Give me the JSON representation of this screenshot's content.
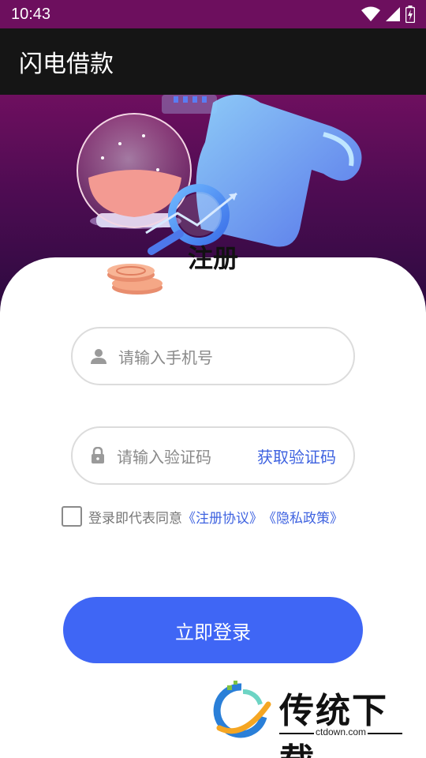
{
  "status_bar": {
    "time": "10:43"
  },
  "app_bar": {
    "title": "闪电借款"
  },
  "page": {
    "title": "注册"
  },
  "form": {
    "phone_placeholder": "请输入手机号",
    "code_placeholder": "请输入验证码",
    "get_code_label": "获取验证码",
    "agreement_text": "登录即代表同意",
    "terms_link": "《注册协议》",
    "privacy_link": "《隐私政策》",
    "agreement_checked": false
  },
  "login_button": {
    "label": "立即登录"
  },
  "watermark": {
    "brand": "传统下载",
    "site": "ctdown.com"
  },
  "colors": {
    "accent": "#3f66f5",
    "link": "#3f63e0",
    "status_bar": "#6d0f5e",
    "app_bar": "#151515"
  }
}
